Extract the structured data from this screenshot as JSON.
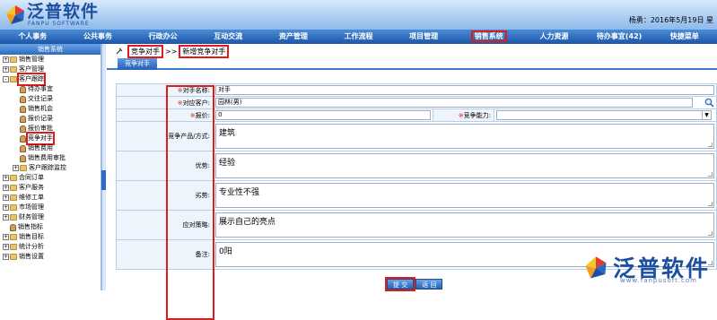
{
  "header": {
    "logo_text": "泛普软件",
    "logo_sub": "FANPU SOFTWARE",
    "user_info": "杨勇：2016年5月19日 星"
  },
  "nav": {
    "items": [
      "个人事务",
      "公共事务",
      "行政办公",
      "互动交流",
      "资产管理",
      "工作流程",
      "项目管理",
      "销售系统",
      "人力资源",
      "待办事宜(42)",
      "快捷菜单"
    ],
    "active_index": 7
  },
  "sidebar": {
    "title": "销售系统",
    "items": [
      {
        "label": "销售管理",
        "level": 1,
        "type": "folder",
        "pm": "+"
      },
      {
        "label": "客户管理",
        "level": 1,
        "type": "folder",
        "pm": "+"
      },
      {
        "label": "客户跟踪",
        "level": 1,
        "type": "folder",
        "pm": "-",
        "highlight": true
      },
      {
        "label": "待办事宜",
        "level": 2,
        "type": "page"
      },
      {
        "label": "交往记录",
        "level": 2,
        "type": "page"
      },
      {
        "label": "销售机会",
        "level": 2,
        "type": "page"
      },
      {
        "label": "报价记录",
        "level": 2,
        "type": "page"
      },
      {
        "label": "报价审批",
        "level": 2,
        "type": "page"
      },
      {
        "label": "竞争对手",
        "level": 2,
        "type": "page",
        "highlight": true
      },
      {
        "label": "销售费用",
        "level": 2,
        "type": "page"
      },
      {
        "label": "销售费用审批",
        "level": 2,
        "type": "page"
      },
      {
        "label": "客户跟踪监控",
        "level": 2,
        "type": "folder",
        "pm": "+"
      },
      {
        "label": "合同订单",
        "level": 1,
        "type": "folder",
        "pm": "+"
      },
      {
        "label": "客户服务",
        "level": 1,
        "type": "folder",
        "pm": "+"
      },
      {
        "label": "维修工单",
        "level": 1,
        "type": "folder",
        "pm": "+"
      },
      {
        "label": "市场管理",
        "level": 1,
        "type": "folder",
        "pm": "+"
      },
      {
        "label": "财务管理",
        "level": 1,
        "type": "folder",
        "pm": "+"
      },
      {
        "label": "销售指标",
        "level": 1,
        "type": "page"
      },
      {
        "label": "销售目标",
        "level": 1,
        "type": "folder",
        "pm": "+"
      },
      {
        "label": "统计分析",
        "level": 1,
        "type": "folder",
        "pm": "+"
      },
      {
        "label": "销售设置",
        "level": 1,
        "type": "folder",
        "pm": "+"
      }
    ]
  },
  "breadcrumb": {
    "part1": "竞争对手",
    "sep": ">>",
    "part2": "新增竞争对手"
  },
  "tab_label": "竞争对手",
  "form": {
    "name_label": "对手名称:",
    "name_value": "对手",
    "customer_label": "对应客户:",
    "customer_value": "园林(男)",
    "quote_label": "报价:",
    "quote_value": "0",
    "ability_label": "竞争能力:",
    "ability_value": "",
    "product_label": "竞争产品/方式:",
    "product_value": "建筑",
    "advantage_label": "优势:",
    "advantage_value": "经验",
    "weakness_label": "劣势:",
    "weakness_value": "专业性不强",
    "strategy_label": "应对策略:",
    "strategy_value": "展示自己的亮点",
    "remark_label": "备注:",
    "remark_value": "0阳",
    "required_mark": "※"
  },
  "buttons": {
    "submit": "提 交",
    "back": "返 回"
  },
  "watermark": {
    "text": "泛普软件",
    "url": "www.fanpusoft.com"
  }
}
